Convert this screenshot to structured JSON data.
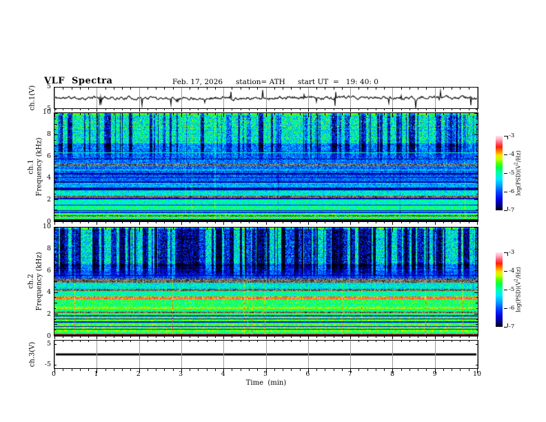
{
  "header": {
    "title": "VLF  Spectra",
    "date": "Feb. 17, 2026",
    "station": "station= ATH",
    "start_ut": "start UT  =   19: 40: 0"
  },
  "x_axis": {
    "label": "Time  (min)",
    "min": 0,
    "max": 10,
    "major_step": 1,
    "minor_step": 0.2,
    "tick_labels": [
      "0",
      "1",
      "2",
      "3",
      "4",
      "5",
      "6",
      "7",
      "8",
      "9",
      "10"
    ]
  },
  "y_axes": {
    "ch1v": {
      "label": "ch.1(V)",
      "ylim": [
        -5,
        5
      ],
      "ticks": [
        5,
        -5
      ],
      "tick_labels": [
        "5",
        "-5"
      ]
    },
    "ch1spec": {
      "label_ch": "ch.1",
      "label_axis": "Frequency  (kHz)",
      "ylim": [
        0,
        10
      ],
      "ticks": [
        10,
        8,
        6,
        4,
        2,
        0
      ],
      "tick_labels": [
        "10",
        "8",
        "6",
        "4",
        "2",
        "0"
      ]
    },
    "ch2spec": {
      "label_ch": "ch.2",
      "label_axis": "Frequency  (kHz)",
      "ylim": [
        0,
        10
      ],
      "ticks": [
        10,
        8,
        6,
        4,
        2,
        0
      ],
      "tick_labels": [
        "10",
        "8",
        "6",
        "4",
        "2",
        "0"
      ]
    },
    "ch3v": {
      "label": "ch.3(V)",
      "ylim": [
        -7,
        7
      ],
      "ticks": [
        5,
        -5
      ],
      "tick_labels": [
        "5",
        "-5"
      ]
    }
  },
  "colorbar": {
    "label_pre": "log(PSD)(V",
    "label_sup": "2",
    "label_post": "/Hz)",
    "min": -7,
    "max": -3,
    "ticks": [
      -3,
      -4,
      -5,
      -6,
      -7
    ],
    "tick_labels": [
      "-3",
      "-4",
      "-5",
      "-6",
      "-7"
    ],
    "stops": [
      [
        0,
        "#000000"
      ],
      [
        0.06,
        "#000078"
      ],
      [
        0.14,
        "#0000e0"
      ],
      [
        0.24,
        "#0040ff"
      ],
      [
        0.33,
        "#00a0ff"
      ],
      [
        0.42,
        "#00e8ff"
      ],
      [
        0.5,
        "#00ffb0"
      ],
      [
        0.57,
        "#00ff50"
      ],
      [
        0.63,
        "#50ff00"
      ],
      [
        0.69,
        "#c8ff00"
      ],
      [
        0.74,
        "#ffe000"
      ],
      [
        0.79,
        "#ff8800"
      ],
      [
        0.85,
        "#ff2200"
      ],
      [
        0.9,
        "#ff5577"
      ],
      [
        0.95,
        "#ffaabb"
      ],
      [
        1,
        "#ffe6ee"
      ]
    ]
  },
  "chart_data": [
    {
      "type": "line",
      "name": "ch.1 voltage waveform",
      "xlabel": "Time (min)",
      "xlim": [
        0,
        10
      ],
      "ylabel": "ch.1(V)",
      "ylim": [
        -5,
        5
      ],
      "description": "broadband noise centered near 0 V with impulsive sferic spikes reaching about +4 and -5 V",
      "render": {
        "seed": 11,
        "ar": 0.72,
        "sigma": 0.55,
        "spike_prob": 0.022,
        "spike_min": 1.2,
        "spike_max": 4.4
      }
    },
    {
      "type": "heatmap",
      "name": "ch.1 VLF spectrogram",
      "xlabel": "Time (min)",
      "xlim": [
        0,
        10
      ],
      "ylabel": "Frequency (kHz)",
      "ylim": [
        0,
        10
      ],
      "zlabel": "log(PSD)(V2/Hz)",
      "zlim": [
        -7,
        -3
      ],
      "description": "green/cyan band 7-10 kHz broken by dark-blue vertical sferic streaks; blue 3.5-7 kHz; cyan-green horizontal line bands below 3 kHz; grey interference bands near 5.2 and 2.3 kHz; black band below 0.2 kHz",
      "render": {
        "seed": 42,
        "bands": [
          {
            "f": [
              0,
              0.22
            ],
            "kind": "black",
            "psd": -6.92,
            "noise": 0.1
          },
          {
            "f": [
              0.22,
              0.45
            ],
            "psd": -4.75,
            "noise": 0.45
          },
          {
            "f": [
              0.45,
              0.55
            ],
            "kind": "grey"
          },
          {
            "f": [
              0.55,
              0.78
            ],
            "psd": -4.7,
            "noise": 0.5
          },
          {
            "f": [
              0.78,
              0.88
            ],
            "psd": -6.2,
            "noise": 0.3
          },
          {
            "f": [
              0.88,
              1.45
            ],
            "psd": -4.95,
            "noise": 0.5
          },
          {
            "f": [
              1.45,
              1.55
            ],
            "psd": -6.35,
            "noise": 0.3
          },
          {
            "f": [
              1.55,
              2.05
            ],
            "psd": -5.1,
            "noise": 0.5
          },
          {
            "f": [
              2.05,
              2.18
            ],
            "psd": -6.5,
            "noise": 0.3
          },
          {
            "f": [
              2.18,
              2.38
            ],
            "kind": "grey"
          },
          {
            "f": [
              2.38,
              2.85
            ],
            "psd": -5.25,
            "noise": 0.5
          },
          {
            "f": [
              2.85,
              3.1
            ],
            "psd": -6.55,
            "noise": 0.35
          },
          {
            "f": [
              3.1,
              3.55
            ],
            "psd": -5.6,
            "noise": 0.5
          },
          {
            "f": [
              3.55,
              3.72
            ],
            "psd": -6.6,
            "noise": 0.3
          },
          {
            "f": [
              3.72,
              4.32
            ],
            "psd": -5.95,
            "noise": 0.45
          },
          {
            "f": [
              4.32,
              4.45
            ],
            "psd": -6.75,
            "noise": 0.2
          },
          {
            "f": [
              4.45,
              5.12
            ],
            "psd": -5.9,
            "noise": 0.5
          },
          {
            "f": [
              5.12,
              5.3
            ],
            "kind": "grey"
          },
          {
            "f": [
              5.3,
              7.2
            ],
            "psd": -5.8,
            "noise": 0.55
          },
          {
            "f": [
              7.2,
              9.8
            ],
            "psd": -5.15,
            "noise": 0.75
          },
          {
            "f": [
              9.8,
              10
            ],
            "psd": -4.5,
            "noise": 0.35
          }
        ],
        "hlines": [
          {
            "f": 6.35,
            "psd": -5.0
          },
          {
            "f": 5.75,
            "psd": -6.7
          },
          {
            "f": 4.75,
            "psd": -5.1
          },
          {
            "f": 4.05,
            "psd": -6.8
          },
          {
            "f": 1.0,
            "psd": -6.6
          }
        ],
        "dots": {
          "range": [
            8.6,
            9.8
          ],
          "prob": 0.03,
          "psd": -4.1
        },
        "streaks": {
          "fade_lo": 5.4,
          "full": 7.0,
          "density": 0.42,
          "strength": 0.4,
          "change": 0.35
        },
        "cols": {
          "p_bright": 0.01,
          "boost": 0.13,
          "p_dark": 0.006,
          "drop": 0.12
        }
      }
    },
    {
      "type": "heatmap",
      "name": "ch.2 VLF spectrogram",
      "xlabel": "Time (min)",
      "xlim": [
        0,
        10
      ],
      "ylabel": "Frequency (kHz)",
      "ylim": [
        0,
        10
      ],
      "zlabel": "log(PSD)(V2/Hz)",
      "zlim": [
        -7,
        -3
      ],
      "description": "cyan 6.6-10 kHz heavily broken by near-black vertical sferic streaks; blue 5.3-6.6 kHz; bright green/yellow horizontal bands below 5 kHz with an orange-red dotted band near 3.5 kHz and a yellow band near 2.6 kHz; grey interference bands near 5.1, 4.2 and 2.2 kHz; thin red line just above the black 0-kHz band",
      "render": {
        "seed": 7,
        "bands": [
          {
            "f": [
              0,
              0.1
            ],
            "kind": "black",
            "psd": -6.92,
            "noise": 0.1
          },
          {
            "f": [
              0.1,
              0.16
            ],
            "psd": -3.6,
            "noise": 0.2
          },
          {
            "f": [
              0.16,
              0.34
            ],
            "psd": -4.95,
            "noise": 0.4
          },
          {
            "f": [
              0.34,
              1.08
            ],
            "psd": -4.45,
            "noise": 0.45
          },
          {
            "f": [
              1.08,
              1.24
            ],
            "psd": -4.7,
            "noise": 0.4
          },
          {
            "f": [
              1.24,
              1.32
            ],
            "psd": -6.35,
            "noise": 0.3
          },
          {
            "f": [
              1.32,
              1.78
            ],
            "psd": -4.6,
            "noise": 0.45
          },
          {
            "f": [
              1.78,
              1.88
            ],
            "psd": -6.25,
            "noise": 0.3
          },
          {
            "f": [
              1.88,
              2.12
            ],
            "psd": -4.8,
            "noise": 0.4
          },
          {
            "f": [
              2.12,
              2.24
            ],
            "kind": "grey"
          },
          {
            "f": [
              2.24,
              2.48
            ],
            "psd": -4.85,
            "noise": 0.4
          },
          {
            "f": [
              2.48,
              2.7
            ],
            "psd": -4.3,
            "noise": 0.35
          },
          {
            "f": [
              2.7,
              3.35
            ],
            "psd": -4.8,
            "noise": 0.45
          },
          {
            "f": [
              3.35,
              3.6
            ],
            "psd": -3.7,
            "noise": 0.45
          },
          {
            "f": [
              3.6,
              4.16
            ],
            "psd": -5.0,
            "noise": 0.45
          },
          {
            "f": [
              4.16,
              4.34
            ],
            "kind": "grey"
          },
          {
            "f": [
              4.34,
              4.92
            ],
            "psd": -5.25,
            "noise": 0.5
          },
          {
            "f": [
              4.92,
              5.3
            ],
            "kind": "grey"
          },
          {
            "f": [
              5.3,
              6.0
            ],
            "psd": -5.9,
            "noise": 0.45
          },
          {
            "f": [
              6.0,
              6.62
            ],
            "psd": -5.75,
            "noise": 0.5
          },
          {
            "f": [
              6.62,
              9.85
            ],
            "psd": -5.25,
            "noise": 0.75
          },
          {
            "f": [
              9.85,
              10
            ],
            "psd": -4.5,
            "noise": 0.35
          }
        ],
        "hlines": [
          {
            "f": 0.62,
            "psd": -6.4
          },
          {
            "f": 0.88,
            "psd": -6.5
          },
          {
            "f": 1.55,
            "psd": -6.6
          },
          {
            "f": 5.6,
            "psd": -6.8
          }
        ],
        "dots": null,
        "streaks": {
          "fade_lo": 5.2,
          "full": 6.6,
          "density": 0.58,
          "strength": 0.5,
          "change": 0.32
        },
        "cols": {
          "p_bright": 0.016,
          "boost": 0.17,
          "p_dark": 0.006,
          "drop": 0.12
        }
      }
    },
    {
      "type": "line",
      "name": "ch.3 voltage",
      "xlabel": "Time (min)",
      "xlim": [
        0,
        10
      ],
      "ylabel": "ch.3(V)",
      "ylim": [
        -7,
        7
      ],
      "constant_V": 0,
      "description": "flat thick black line at 0 V (no signal)",
      "render": {
        "line_width": 3
      }
    }
  ]
}
